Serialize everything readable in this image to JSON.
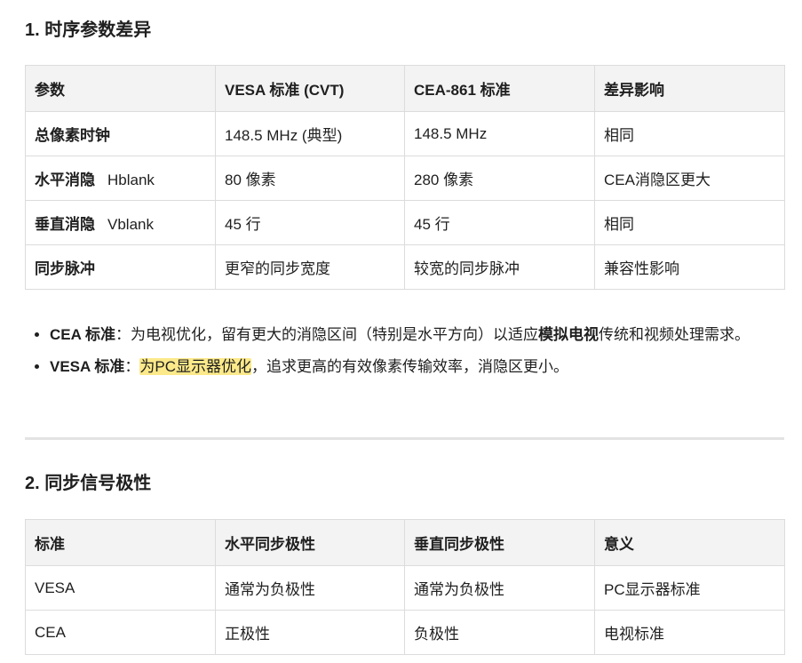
{
  "section1": {
    "heading": "1. 时序参数差异",
    "table": {
      "headers": [
        "参数",
        "VESA 标准 (CVT)",
        "CEA-861 标准",
        "差异影响"
      ],
      "rows": [
        {
          "param": "总像素时钟",
          "param_sub": "",
          "vesa": "148.5 MHz (典型)",
          "cea": "148.5 MHz",
          "impact": "相同"
        },
        {
          "param": "水平消隐",
          "param_sub": "Hblank",
          "vesa": "80 像素",
          "cea": "280 像素",
          "impact": "CEA消隐区更大"
        },
        {
          "param": "垂直消隐",
          "param_sub": "Vblank",
          "vesa": "45 行",
          "cea": "45 行",
          "impact": "相同"
        },
        {
          "param": "同步脉冲",
          "param_sub": "",
          "vesa": "更窄的同步宽度",
          "cea": "较宽的同步脉冲",
          "impact": "兼容性影响"
        }
      ]
    },
    "bullets": [
      {
        "label": "CEA 标准",
        "sep": "：",
        "text_a": "为电视优化，留有更大的消隐区间（特别是水平方向）以适应",
        "bold_mid": "模拟电视",
        "text_b": "传统和视频处理需求。"
      },
      {
        "label": "VESA 标准",
        "sep": "：",
        "highlight": "为PC显示器优化",
        "text_b": "，追求更高的有效像素传输效率，消隐区更小。"
      }
    ]
  },
  "section2": {
    "heading": "2. 同步信号极性",
    "table": {
      "headers": [
        "标准",
        "水平同步极性",
        "垂直同步极性",
        "意义"
      ],
      "rows": [
        {
          "std": "VESA",
          "h": "通常为负极性",
          "v": "通常为负极性",
          "meaning": "PC显示器标准"
        },
        {
          "std": "CEA",
          "h": "正极性",
          "v": "负极性",
          "meaning": "电视标准"
        }
      ]
    }
  },
  "colors": {
    "header_bg": "#f3f3f3",
    "border": "#dcdcdc",
    "highlight": "#fbe98a",
    "text": "#1f1f1f"
  }
}
